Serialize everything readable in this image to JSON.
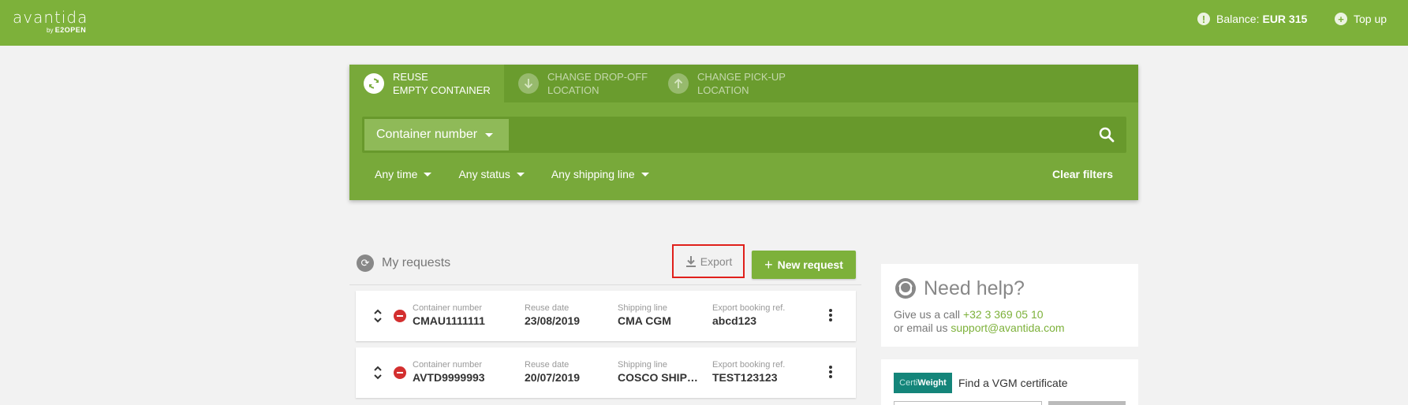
{
  "topbar": {
    "logo_main": "avantida",
    "logo_by": "by",
    "logo_sub": "E2OPEN",
    "balance_label": "Balance:",
    "balance_value": "EUR 315",
    "topup_label": "Top up",
    "balance_icon": "info-icon",
    "topup_icon": "plus-circle-icon"
  },
  "tabs": [
    {
      "line1": "REUSE",
      "line2": "EMPTY CONTAINER",
      "icon": "refresh-icon",
      "active": true
    },
    {
      "line1": "CHANGE DROP-OFF",
      "line2": "LOCATION",
      "icon": "arrow-down-icon",
      "active": false
    },
    {
      "line1": "CHANGE PICK-UP",
      "line2": "LOCATION",
      "icon": "arrow-up-icon",
      "active": false
    }
  ],
  "search": {
    "field_select": "Container number",
    "input_value": ""
  },
  "filters": {
    "time": "Any time",
    "status": "Any status",
    "shipping_line": "Any shipping line",
    "clear": "Clear filters"
  },
  "requests": {
    "title": "My requests",
    "export_label": "Export",
    "new_label": "New request",
    "columns": {
      "container": "Container number",
      "reuse_date": "Reuse date",
      "shipping_line": "Shipping line",
      "booking_ref": "Export booking ref."
    },
    "rows": [
      {
        "container": "CMAU1111111",
        "reuse_date": "23/08/2019",
        "shipping_line": "CMA CGM",
        "booking_ref": "abcd123"
      },
      {
        "container": "AVTD9999993",
        "reuse_date": "20/07/2019",
        "shipping_line": "COSCO SHIPPI…",
        "booking_ref": "TEST123123"
      }
    ]
  },
  "help": {
    "title": "Need help?",
    "call_prefix": "Give us a call",
    "phone": "+32 3 369 05 10",
    "email_prefix": "or email us",
    "email": "support@avantida.com"
  },
  "certiweight": {
    "badge_light": "Certi",
    "badge_bold": "Weight",
    "text": "Find a VGM certificate"
  },
  "colors": {
    "brand_green": "#7db13a",
    "panel_green": "#78a93a",
    "highlight_red": "#e0201b",
    "status_red": "#d32f2f"
  }
}
